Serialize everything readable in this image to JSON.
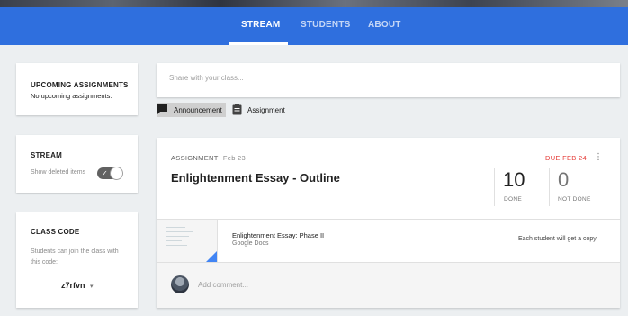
{
  "nav": {
    "tabs": [
      {
        "label": "STREAM",
        "active": true
      },
      {
        "label": "STUDENTS",
        "active": false
      },
      {
        "label": "ABOUT",
        "active": false
      }
    ]
  },
  "sidebar": {
    "upcoming": {
      "title": "UPCOMING ASSIGNMENTS",
      "text": "No upcoming assignments."
    },
    "stream": {
      "title": "STREAM",
      "toggle_label": "Show deleted items",
      "toggle_on": true
    },
    "class_code": {
      "title": "CLASS CODE",
      "description": "Students can join the class with this code:",
      "code": "z7rfvn"
    }
  },
  "share": {
    "placeholder": "Share with your class...",
    "post_types": [
      {
        "label": "Announcement",
        "icon": "announcement-icon",
        "selected": true
      },
      {
        "label": "Assignment",
        "icon": "assignment-icon",
        "selected": false
      }
    ]
  },
  "assignment": {
    "type_label": "ASSIGNMENT",
    "posted_date": "Feb 23",
    "title": "Enlightenment Essay - Outline",
    "due": "DUE FEB 24",
    "done_count": "10",
    "done_label": "DONE",
    "not_done_count": "0",
    "not_done_label": "NOT DONE",
    "attachment": {
      "title": "Enlightenment Essay: Phase II",
      "source": "Google Docs",
      "copy_note": "Each student will get a copy"
    },
    "comment_placeholder": "Add comment..."
  },
  "colors": {
    "nav_bar": "#2f6fde",
    "due_red": "#e53935",
    "docs_blue": "#4285f4"
  }
}
